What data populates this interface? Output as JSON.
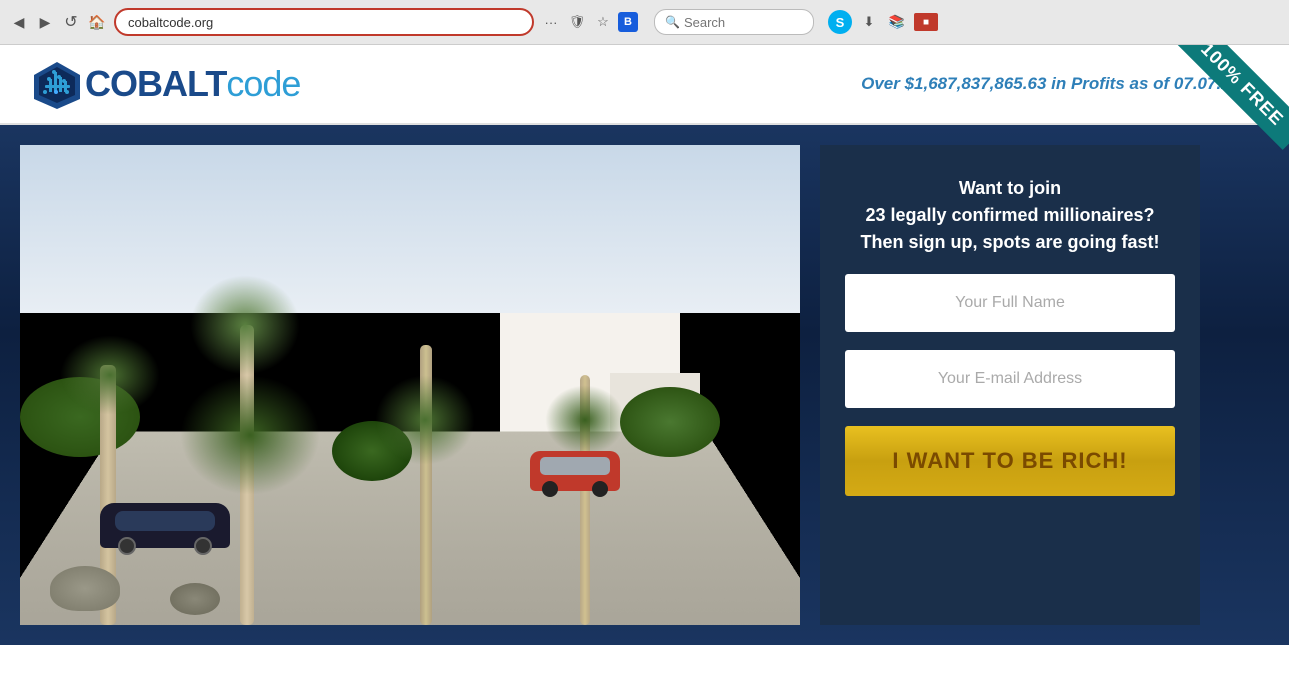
{
  "browser": {
    "url": "cobaltcode.org",
    "search_placeholder": "Search",
    "back_label": "◀",
    "forward_label": "▶",
    "home_label": "🏠",
    "reload_label": "↺",
    "more_label": "···"
  },
  "header": {
    "logo_cobalt": "COBALT",
    "logo_code": "code",
    "tagline": "Over $1,687,837,865.63 in Profits as of 07.07.2017",
    "free_banner": "100% FREE"
  },
  "hero": {
    "signup_heading": "Want to join\n23 legally confirmed millionaires?\nThen sign up, spots are going fast!",
    "name_placeholder": "Your Full Name",
    "email_placeholder": "Your E-mail Address",
    "cta_label": "I WANT TO BE RICH!"
  }
}
